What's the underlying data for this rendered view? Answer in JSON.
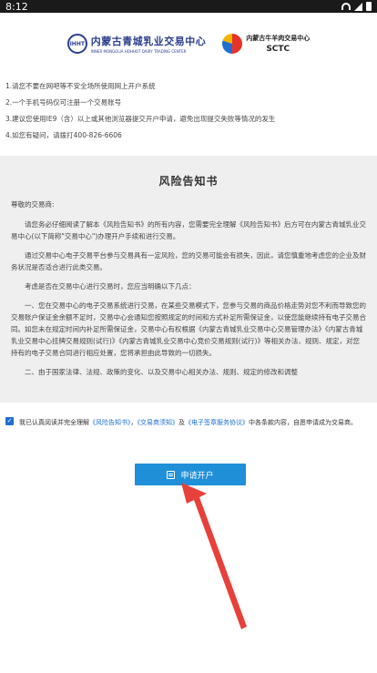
{
  "status_bar": {
    "time": "8:12"
  },
  "logos": {
    "a_mark": "IHHT",
    "a_cn": "内蒙古青城乳业交易中心",
    "a_en": "INNER MONGOLIA HOHHOT DAIRY TRADING CENTER",
    "b_cn": "内蒙古牛羊肉交易中心",
    "b_en": "SCTC"
  },
  "notices": [
    "1.请您不要在网吧等不安全场所使用网上开户系统",
    "2.一个手机号码仅可注册一个交易账号",
    "3.建议您使用IE9（含）以上或其他浏览器提交开户申请，避免出现提交失败等情况的发生",
    "4.如您有疑问，请拨打400-826-6606"
  ],
  "risk": {
    "title": "风险告知书",
    "greeting": "尊敬的交易商:",
    "paragraphs": [
      "请您务必仔细阅读了解本《风险告知书》的所有内容，您需要完全理解《风险告知书》后方可在内蒙古青城乳业交易中心(以下简称\"交易中心\")办理开户手续和进行交易。",
      "通过交易中心电子交易平台参与交易具有一定风险，您的交易可能会有损失，因此，请您慎重地考虑您的企业及财务状况是否适合进行此类交易。",
      "考虑是否在交易中心进行交易时，您应当明确以下几点：",
      "一、您在交易中心的电子交易系统进行交易，在某些交易模式下，您参与交易的商品价格走势对您不利而导致您的交易账户保证金余额不足时，交易中心会通知您按照规定的时间和方式补足所需保证金，以使您能继续持有电子交易合同。如您未在规定时间内补足所需保证金，交易中心有权根据《内蒙古青城乳业交易中心交易管理办法》《内蒙古青城乳业交易中心挂牌交易规则(试行)》《内蒙古青城乳业交易中心竞价交易规则(试行)》等相关办法、规则、规定，对您持有的电子交易合同进行相应处置，您将承担由此导致的一切损失。",
      "二、由于国家法律、法规、政策的变化、以及交易中心相关办法、规则、规定的修改和调整"
    ]
  },
  "agreement": {
    "prefix": "我已认真阅读并完全理解",
    "doc1": "《风险告知书》",
    "sep1": "，",
    "doc2": "《交易商须知》",
    "sep2": "及",
    "doc3": "《电子签章服务协议》",
    "suffix": "中各条款内容，自愿申请成为交易商。"
  },
  "apply_button": {
    "label": "申请开户"
  }
}
